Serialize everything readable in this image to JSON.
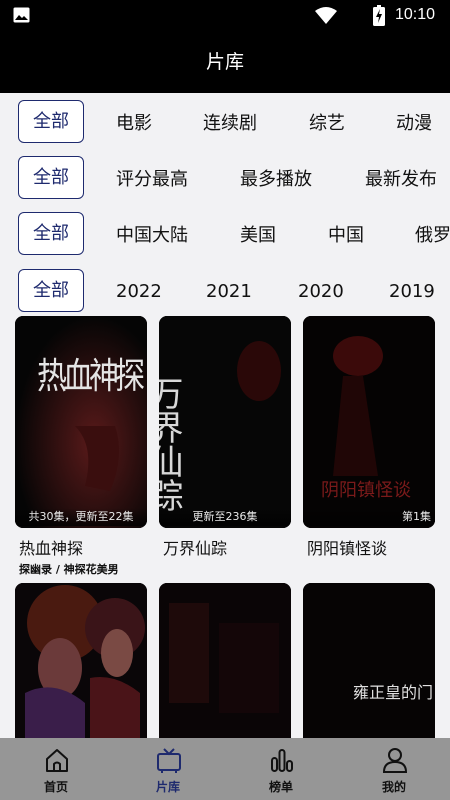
{
  "status": {
    "time": "10:10",
    "icons": [
      "gallery-icon",
      "wifi-icon",
      "battery-charging-icon"
    ]
  },
  "header": {
    "title": "片库"
  },
  "filters": [
    {
      "all_label": "全部",
      "options": [
        "电影",
        "连续剧",
        "综艺",
        "动漫"
      ]
    },
    {
      "all_label": "全部",
      "options": [
        "评分最高",
        "最多播放",
        "最新发布"
      ]
    },
    {
      "all_label": "全部",
      "options": [
        "中国大陆",
        "美国",
        "中国",
        "俄罗"
      ]
    },
    {
      "all_label": "全部",
      "options": [
        "2022",
        "2021",
        "2020",
        "2019"
      ]
    }
  ],
  "shows": [
    {
      "title": "热血神探",
      "badge": "共30集，更新至22集",
      "subtitle": "探幽录 / 神探花美男",
      "poster_text": "热血神探"
    },
    {
      "title": "万界仙踪",
      "badge": "更新至236集",
      "subtitle": "",
      "poster_text": "万界仙踪"
    },
    {
      "title": "阴阳镇怪谈",
      "badge": "第1集",
      "subtitle": "",
      "poster_text": "阴阳镇怪谈"
    },
    {
      "title": "",
      "badge": "",
      "subtitle": "",
      "poster_text": ""
    },
    {
      "title": "",
      "badge": "",
      "subtitle": "",
      "poster_text": ""
    },
    {
      "title": "",
      "badge": "",
      "subtitle": "",
      "poster_text": "雍正皇的门"
    }
  ],
  "tabs": [
    {
      "label": "首页",
      "icon": "home-icon",
      "active": false
    },
    {
      "label": "片库",
      "icon": "tv-icon",
      "active": true
    },
    {
      "label": "榜单",
      "icon": "bar-chart-icon",
      "active": false
    },
    {
      "label": "我的",
      "icon": "user-icon",
      "active": false
    }
  ],
  "colors": {
    "accent": "#1e2a6e",
    "tab_bar": "#969696",
    "header": "#000000",
    "background": "#f2f2f4"
  }
}
